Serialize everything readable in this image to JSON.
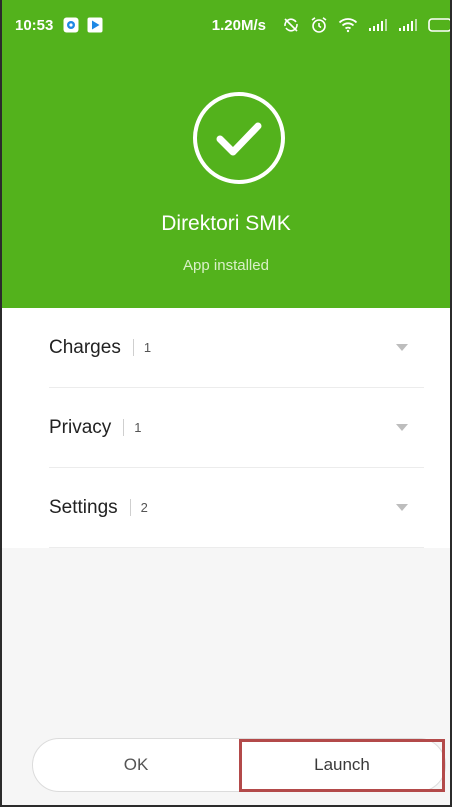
{
  "status_bar": {
    "time": "10:53",
    "left_icons": [
      "app-notification-icon",
      "play-store-icon"
    ],
    "speed": "1.20M/s",
    "right_icons": [
      "sync-off-icon",
      "alarm-icon",
      "wifi-icon",
      "signal-icon",
      "signal-icon",
      "battery-icon"
    ]
  },
  "header": {
    "app_name": "Direktori SMK",
    "status": "App installed",
    "background_color": "#53b21c"
  },
  "sections": [
    {
      "label": "Charges",
      "count": "1"
    },
    {
      "label": "Privacy",
      "count": "1"
    },
    {
      "label": "Settings",
      "count": "2"
    }
  ],
  "buttons": {
    "ok": "OK",
    "launch": "Launch"
  }
}
